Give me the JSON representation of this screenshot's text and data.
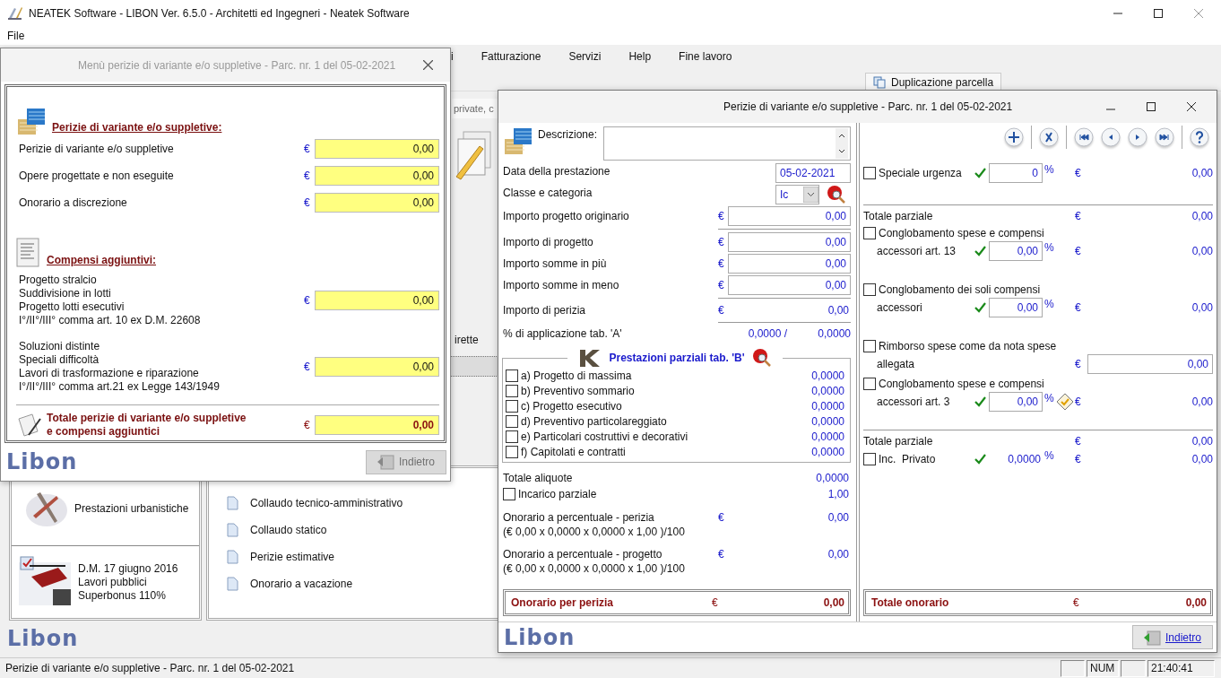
{
  "app": {
    "title": "NEATEK Software - LIBON Ver. 6.5.0 - Architetti ed Ingegneri - Neatek Software",
    "menu": [
      "File"
    ]
  },
  "background": {
    "menu": [
      "i",
      "Fatturazione",
      "Servizi",
      "Help",
      "Fine lavoro"
    ],
    "toolbar_button": "Duplicazione parcella",
    "search_hint": "private, c",
    "cut_text": "irette",
    "left_panel": [
      {
        "kind": "urban",
        "lines": [
          "Prestazioni urbanistiche"
        ]
      },
      {
        "kind": "decree",
        "lines": [
          "D.M. 17 giugno 2016",
          "Lavori pubblici",
          "Superbonus 110%"
        ]
      }
    ],
    "services": [
      "Collaudo tecnico-amministrativo",
      "Collaudo statico",
      "Perizie estimative",
      "Onorario a vacazione"
    ],
    "logo": "Libon"
  },
  "menu_dialog": {
    "title": "Menù perizie di variante e/o suppletive - Parc. nr. 1  del 05-02-2021",
    "sections": [
      {
        "kind": "variants",
        "heading": "Perizie di variante e/o suppletive:",
        "rows": [
          {
            "lines": [
              "Perizie di variante e/o suppletive"
            ],
            "currency": "€",
            "value": "0,00"
          },
          {
            "lines": [
              "Opere progettate e non eseguite"
            ],
            "currency": "€",
            "value": "0,00"
          },
          {
            "lines": [
              "Onorario a discrezione"
            ],
            "currency": "€",
            "value": "0,00"
          }
        ]
      },
      {
        "kind": "extras",
        "heading": "Compensi aggiuntivi:",
        "rows": [
          {
            "lines": [
              "Progetto stralcio",
              "Suddivisione in lotti",
              "Progetto lotti esecutivi",
              "I°/II°/III° comma art. 10 ex D.M. 22608"
            ],
            "currency": "€",
            "value": "0,00"
          },
          {
            "lines": [
              "Soluzioni distinte",
              "Speciali difficoltà",
              "Lavori di trasformazione e riparazione",
              "I°/II°/III° comma art.21 ex Legge 143/1949"
            ],
            "currency": "€",
            "value": "0,00"
          }
        ]
      }
    ],
    "total": {
      "lines": [
        "Totale perizie di variante e/o suppletive",
        "e compensi aggiuntici"
      ],
      "currency": "€",
      "value": "0,00"
    },
    "logo": "Libon",
    "back_button": {
      "label": "Indietro",
      "disabled": true
    }
  },
  "detail_window": {
    "title": "Perizie di variante e/o suppletive - Parc. nr. 1  del 05-02-2021",
    "description": {
      "label": "Descrizione:"
    },
    "date": {
      "label": "Data della prestazione",
      "value": "05-02-2021"
    },
    "category": {
      "label": "Classe e categoria",
      "value": "Ic"
    },
    "amounts": [
      {
        "kind": "input",
        "label": "Importo progetto originario",
        "currency": "€",
        "value": "0,00"
      },
      {
        "kind": "input",
        "label": "Importo di progetto",
        "currency": "€",
        "value": "0,00"
      },
      {
        "kind": "input",
        "label": "Importo somme in più",
        "currency": "€",
        "value": "0,00"
      },
      {
        "kind": "input",
        "label": "Importo somme in meno",
        "currency": "€",
        "value": "0,00"
      },
      {
        "kind": "readout",
        "label": "Importo di perizia",
        "currency": "€",
        "value": "0,00"
      },
      {
        "kind": "ratio",
        "label": "% di applicazione tab. 'A'",
        "value": "0,0000 /",
        "value_2": "0,0000"
      }
    ],
    "partial_services": {
      "title": "Prestazioni parziali tab. 'B'",
      "items": [
        {
          "label": "a) Progetto di massima",
          "checked": false,
          "value": "0,0000"
        },
        {
          "label": "b) Preventivo sommario",
          "checked": false,
          "value": "0,0000"
        },
        {
          "label": "c) Progetto esecutivo",
          "checked": false,
          "value": "0,0000"
        },
        {
          "label": "d) Preventivo particolareggiato",
          "checked": false,
          "value": "0,0000"
        },
        {
          "label": "e) Particolari costruttivi e decorativi",
          "checked": false,
          "value": "0,0000"
        },
        {
          "label": "f) Capitolati e contratti",
          "checked": false,
          "value": "0,0000"
        }
      ]
    },
    "total_rates": {
      "label": "Totale aliquote",
      "value": "0,0000"
    },
    "partial_assignment": {
      "label": "Incarico parziale",
      "checked": false,
      "value": "1,00"
    },
    "fees": [
      {
        "label": "Onorario a percentuale - perizia",
        "currency": "€",
        "value": "0,00",
        "formula": "(€ 0,00 x 0,0000 x 0,0000 x 1,00 )/100"
      },
      {
        "label": "Onorario a percentuale - progetto",
        "currency": "€",
        "value": "0,00",
        "formula": "(€ 0,00 x 0,0000 x 0,0000 x 1,00 )/100"
      }
    ],
    "total": {
      "label": "Onorario per perizia",
      "currency": "€",
      "value": "0,00"
    },
    "extras": [
      {
        "items": [
          {
            "kind": "option",
            "lines": [
              "Speciale urgenza"
            ],
            "checked": false,
            "valid": true,
            "percent": "0",
            "percent_editable": true,
            "unit": "%",
            "note_icon": false,
            "currency": "€",
            "value": "0,00"
          }
        ]
      },
      {
        "items": [
          {
            "kind": "subtotal",
            "label": "Totale parziale",
            "currency": "€",
            "value": "0,00"
          },
          {
            "kind": "option",
            "lines": [
              "Conglobamento spese e compensi",
              "accessori art. 13"
            ],
            "checked": false,
            "valid": true,
            "percent": "0,00",
            "percent_editable": true,
            "unit": "%",
            "note_icon": false,
            "currency": "€",
            "value": "0,00"
          },
          {
            "kind": "option",
            "lines": [
              "Conglobamento dei soli compensi",
              "accessori"
            ],
            "checked": false,
            "valid": true,
            "percent": "0,00",
            "percent_editable": true,
            "unit": "%",
            "note_icon": false,
            "currency": "€",
            "value": "0,00"
          },
          {
            "kind": "refund",
            "lines": [
              "Rimborso spese come da nota spese",
              "allegata"
            ],
            "checked": false,
            "currency": "€",
            "value": "0,00"
          },
          {
            "kind": "option",
            "lines": [
              "Conglobamento spese e compensi",
              "accessori art. 3"
            ],
            "checked": false,
            "valid": true,
            "percent": "0,00",
            "percent_editable": true,
            "unit": "%",
            "note_icon": true,
            "currency": "€",
            "value": "0,00"
          }
        ]
      },
      {
        "items": [
          {
            "kind": "subtotal",
            "label": "Totale parziale",
            "currency": "€",
            "value": "0,00"
          },
          {
            "kind": "option",
            "lines": [
              "Inc.  Privato"
            ],
            "checked": false,
            "valid": true,
            "percent": "0,0000",
            "percent_editable": false,
            "unit": "%",
            "note_icon": false,
            "currency": "€",
            "value": "0,00"
          }
        ]
      }
    ],
    "extras_total": {
      "label": "Totale onorario",
      "currency": "€",
      "value": "0,00"
    },
    "logo": "Libon",
    "back_button": {
      "label": "Indietro",
      "disabled": false
    }
  },
  "status_bar": {
    "text": "Perizie di variante e/o suppletive - Parc. nr. 1  del 05-02-2021",
    "num": "NUM",
    "time": "21:40:41"
  }
}
